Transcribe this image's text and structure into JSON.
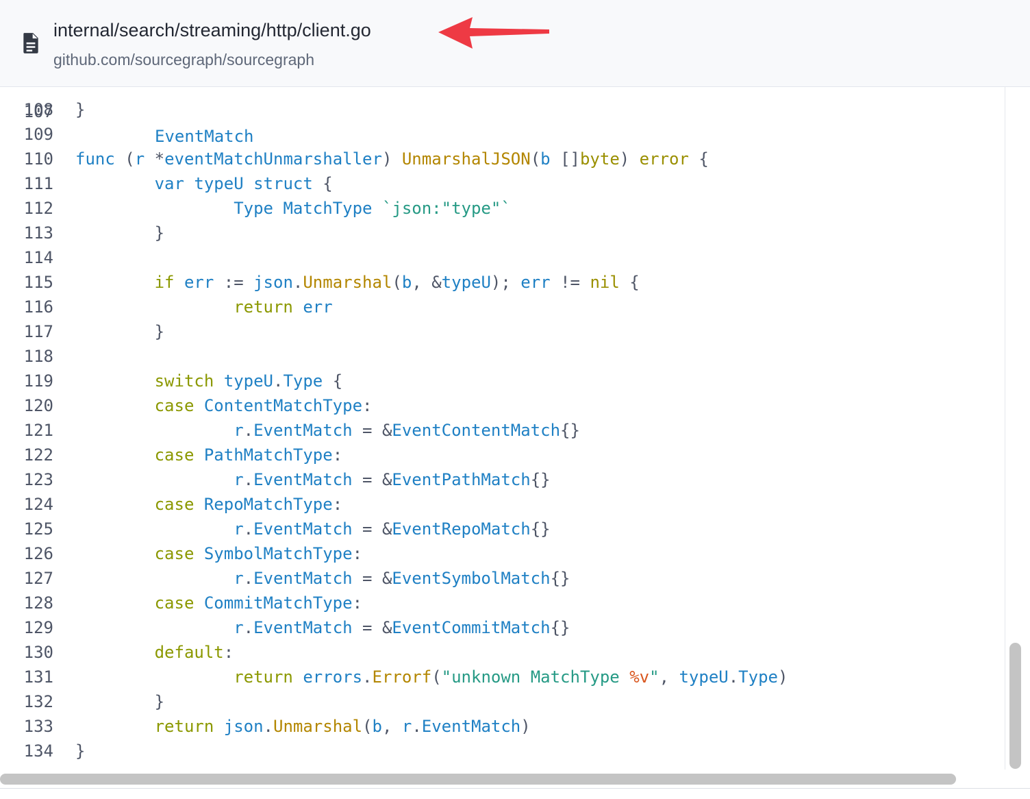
{
  "header": {
    "file_icon": "file-document-icon",
    "file_path": "internal/search/streaming/http/client.go",
    "repo_name": "github.com/sourcegraph/sourcegraph",
    "annotation_arrow_color": "#ee3a44"
  },
  "code": {
    "partial_line": {
      "number": "107",
      "text": "EventMatch"
    },
    "lines": [
      {
        "number": "108",
        "segments": [
          {
            "t": "}",
            "c": "t-punct"
          }
        ]
      },
      {
        "number": "109",
        "segments": []
      },
      {
        "number": "110",
        "segments": [
          {
            "t": "func",
            "c": "t-kw"
          },
          {
            "t": " ",
            "c": "t-punct"
          },
          {
            "t": "(",
            "c": "t-punct"
          },
          {
            "t": "r",
            "c": "t-ident"
          },
          {
            "t": " ",
            "c": "t-punct"
          },
          {
            "t": "*",
            "c": "t-punct"
          },
          {
            "t": "eventMatchUnmarshaller",
            "c": "t-ident"
          },
          {
            "t": ") ",
            "c": "t-punct"
          },
          {
            "t": "UnmarshalJSON",
            "c": "t-fn"
          },
          {
            "t": "(",
            "c": "t-punct"
          },
          {
            "t": "b",
            "c": "t-ident"
          },
          {
            "t": " ",
            "c": "t-punct"
          },
          {
            "t": "[]",
            "c": "t-punct"
          },
          {
            "t": "byte",
            "c": "t-type"
          },
          {
            "t": ") ",
            "c": "t-punct"
          },
          {
            "t": "error",
            "c": "t-type"
          },
          {
            "t": " {",
            "c": "t-punct"
          }
        ]
      },
      {
        "number": "111",
        "segments": [
          {
            "t": "        ",
            "c": "t-punct"
          },
          {
            "t": "var",
            "c": "t-kw"
          },
          {
            "t": " ",
            "c": "t-punct"
          },
          {
            "t": "typeU",
            "c": "t-ident"
          },
          {
            "t": " ",
            "c": "t-punct"
          },
          {
            "t": "struct",
            "c": "t-kw"
          },
          {
            "t": " {",
            "c": "t-punct"
          }
        ]
      },
      {
        "number": "112",
        "segments": [
          {
            "t": "                ",
            "c": "t-punct"
          },
          {
            "t": "Type",
            "c": "t-ident"
          },
          {
            "t": " ",
            "c": "t-punct"
          },
          {
            "t": "MatchType",
            "c": "t-ident"
          },
          {
            "t": " ",
            "c": "t-punct"
          },
          {
            "t": "`json:\"type\"`",
            "c": "t-str"
          }
        ]
      },
      {
        "number": "113",
        "segments": [
          {
            "t": "        }",
            "c": "t-punct"
          }
        ]
      },
      {
        "number": "114",
        "segments": []
      },
      {
        "number": "115",
        "segments": [
          {
            "t": "        ",
            "c": "t-punct"
          },
          {
            "t": "if",
            "c": "t-ctl"
          },
          {
            "t": " ",
            "c": "t-punct"
          },
          {
            "t": "err",
            "c": "t-ident"
          },
          {
            "t": " := ",
            "c": "t-punct"
          },
          {
            "t": "json",
            "c": "t-ident"
          },
          {
            "t": ".",
            "c": "t-punct"
          },
          {
            "t": "Unmarshal",
            "c": "t-fn"
          },
          {
            "t": "(",
            "c": "t-punct"
          },
          {
            "t": "b",
            "c": "t-ident"
          },
          {
            "t": ", &",
            "c": "t-punct"
          },
          {
            "t": "typeU",
            "c": "t-ident"
          },
          {
            "t": "); ",
            "c": "t-punct"
          },
          {
            "t": "err",
            "c": "t-ident"
          },
          {
            "t": " != ",
            "c": "t-punct"
          },
          {
            "t": "nil",
            "c": "t-type"
          },
          {
            "t": " {",
            "c": "t-punct"
          }
        ]
      },
      {
        "number": "116",
        "segments": [
          {
            "t": "                ",
            "c": "t-punct"
          },
          {
            "t": "return",
            "c": "t-ctl"
          },
          {
            "t": " ",
            "c": "t-punct"
          },
          {
            "t": "err",
            "c": "t-ident"
          }
        ]
      },
      {
        "number": "117",
        "segments": [
          {
            "t": "        }",
            "c": "t-punct"
          }
        ]
      },
      {
        "number": "118",
        "segments": []
      },
      {
        "number": "119",
        "segments": [
          {
            "t": "        ",
            "c": "t-punct"
          },
          {
            "t": "switch",
            "c": "t-ctl"
          },
          {
            "t": " ",
            "c": "t-punct"
          },
          {
            "t": "typeU",
            "c": "t-ident"
          },
          {
            "t": ".",
            "c": "t-punct"
          },
          {
            "t": "Type",
            "c": "t-ident"
          },
          {
            "t": " {",
            "c": "t-punct"
          }
        ]
      },
      {
        "number": "120",
        "segments": [
          {
            "t": "        ",
            "c": "t-punct"
          },
          {
            "t": "case",
            "c": "t-ctl"
          },
          {
            "t": " ",
            "c": "t-punct"
          },
          {
            "t": "ContentMatchType",
            "c": "t-ident"
          },
          {
            "t": ":",
            "c": "t-punct"
          }
        ]
      },
      {
        "number": "121",
        "segments": [
          {
            "t": "                ",
            "c": "t-punct"
          },
          {
            "t": "r",
            "c": "t-ident"
          },
          {
            "t": ".",
            "c": "t-punct"
          },
          {
            "t": "EventMatch",
            "c": "t-ident"
          },
          {
            "t": " = &",
            "c": "t-punct"
          },
          {
            "t": "EventContentMatch",
            "c": "t-ident"
          },
          {
            "t": "{}",
            "c": "t-punct"
          }
        ]
      },
      {
        "number": "122",
        "segments": [
          {
            "t": "        ",
            "c": "t-punct"
          },
          {
            "t": "case",
            "c": "t-ctl"
          },
          {
            "t": " ",
            "c": "t-punct"
          },
          {
            "t": "PathMatchType",
            "c": "t-ident"
          },
          {
            "t": ":",
            "c": "t-punct"
          }
        ]
      },
      {
        "number": "123",
        "segments": [
          {
            "t": "                ",
            "c": "t-punct"
          },
          {
            "t": "r",
            "c": "t-ident"
          },
          {
            "t": ".",
            "c": "t-punct"
          },
          {
            "t": "EventMatch",
            "c": "t-ident"
          },
          {
            "t": " = &",
            "c": "t-punct"
          },
          {
            "t": "EventPathMatch",
            "c": "t-ident"
          },
          {
            "t": "{}",
            "c": "t-punct"
          }
        ]
      },
      {
        "number": "124",
        "segments": [
          {
            "t": "        ",
            "c": "t-punct"
          },
          {
            "t": "case",
            "c": "t-ctl"
          },
          {
            "t": " ",
            "c": "t-punct"
          },
          {
            "t": "RepoMatchType",
            "c": "t-ident"
          },
          {
            "t": ":",
            "c": "t-punct"
          }
        ]
      },
      {
        "number": "125",
        "segments": [
          {
            "t": "                ",
            "c": "t-punct"
          },
          {
            "t": "r",
            "c": "t-ident"
          },
          {
            "t": ".",
            "c": "t-punct"
          },
          {
            "t": "EventMatch",
            "c": "t-ident"
          },
          {
            "t": " = &",
            "c": "t-punct"
          },
          {
            "t": "EventRepoMatch",
            "c": "t-ident"
          },
          {
            "t": "{}",
            "c": "t-punct"
          }
        ]
      },
      {
        "number": "126",
        "segments": [
          {
            "t": "        ",
            "c": "t-punct"
          },
          {
            "t": "case",
            "c": "t-ctl"
          },
          {
            "t": " ",
            "c": "t-punct"
          },
          {
            "t": "SymbolMatchType",
            "c": "t-ident"
          },
          {
            "t": ":",
            "c": "t-punct"
          }
        ]
      },
      {
        "number": "127",
        "segments": [
          {
            "t": "                ",
            "c": "t-punct"
          },
          {
            "t": "r",
            "c": "t-ident"
          },
          {
            "t": ".",
            "c": "t-punct"
          },
          {
            "t": "EventMatch",
            "c": "t-ident"
          },
          {
            "t": " = &",
            "c": "t-punct"
          },
          {
            "t": "EventSymbolMatch",
            "c": "t-ident"
          },
          {
            "t": "{}",
            "c": "t-punct"
          }
        ]
      },
      {
        "number": "128",
        "segments": [
          {
            "t": "        ",
            "c": "t-punct"
          },
          {
            "t": "case",
            "c": "t-ctl"
          },
          {
            "t": " ",
            "c": "t-punct"
          },
          {
            "t": "CommitMatchType",
            "c": "t-ident"
          },
          {
            "t": ":",
            "c": "t-punct"
          }
        ]
      },
      {
        "number": "129",
        "segments": [
          {
            "t": "                ",
            "c": "t-punct"
          },
          {
            "t": "r",
            "c": "t-ident"
          },
          {
            "t": ".",
            "c": "t-punct"
          },
          {
            "t": "EventMatch",
            "c": "t-ident"
          },
          {
            "t": " = &",
            "c": "t-punct"
          },
          {
            "t": "EventCommitMatch",
            "c": "t-ident"
          },
          {
            "t": "{}",
            "c": "t-punct"
          }
        ]
      },
      {
        "number": "130",
        "segments": [
          {
            "t": "        ",
            "c": "t-punct"
          },
          {
            "t": "default",
            "c": "t-ctl"
          },
          {
            "t": ":",
            "c": "t-punct"
          }
        ]
      },
      {
        "number": "131",
        "segments": [
          {
            "t": "                ",
            "c": "t-punct"
          },
          {
            "t": "return",
            "c": "t-ctl"
          },
          {
            "t": " ",
            "c": "t-punct"
          },
          {
            "t": "errors",
            "c": "t-ident"
          },
          {
            "t": ".",
            "c": "t-punct"
          },
          {
            "t": "Errorf",
            "c": "t-fn"
          },
          {
            "t": "(",
            "c": "t-punct"
          },
          {
            "t": "\"unknown MatchType ",
            "c": "t-str"
          },
          {
            "t": "%v",
            "c": "t-fmt"
          },
          {
            "t": "\"",
            "c": "t-str"
          },
          {
            "t": ", ",
            "c": "t-punct"
          },
          {
            "t": "typeU",
            "c": "t-ident"
          },
          {
            "t": ".",
            "c": "t-punct"
          },
          {
            "t": "Type",
            "c": "t-ident"
          },
          {
            "t": ")",
            "c": "t-punct"
          }
        ]
      },
      {
        "number": "132",
        "segments": [
          {
            "t": "        }",
            "c": "t-punct"
          }
        ]
      },
      {
        "number": "133",
        "segments": [
          {
            "t": "        ",
            "c": "t-punct"
          },
          {
            "t": "return",
            "c": "t-ctl"
          },
          {
            "t": " ",
            "c": "t-punct"
          },
          {
            "t": "json",
            "c": "t-ident"
          },
          {
            "t": ".",
            "c": "t-punct"
          },
          {
            "t": "Unmarshal",
            "c": "t-fn"
          },
          {
            "t": "(",
            "c": "t-punct"
          },
          {
            "t": "b",
            "c": "t-ident"
          },
          {
            "t": ", ",
            "c": "t-punct"
          },
          {
            "t": "r",
            "c": "t-ident"
          },
          {
            "t": ".",
            "c": "t-punct"
          },
          {
            "t": "EventMatch",
            "c": "t-ident"
          },
          {
            "t": ")",
            "c": "t-punct"
          }
        ]
      },
      {
        "number": "134",
        "segments": [
          {
            "t": "}",
            "c": "t-punct"
          }
        ]
      }
    ]
  }
}
